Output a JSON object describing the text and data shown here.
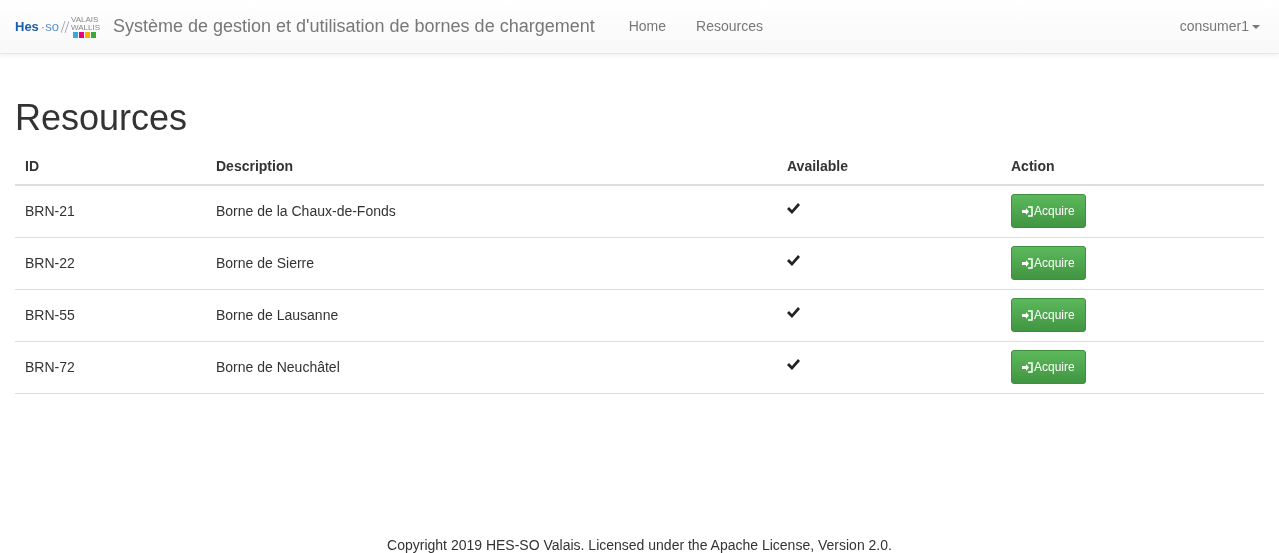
{
  "navbar": {
    "logo": {
      "brand": "Hes",
      "brand_suffix": "·so",
      "region": [
        "VALAIS",
        "WALLIS"
      ]
    },
    "title": "Système de gestion et d'utilisation de bornes de chargement",
    "links": [
      {
        "label": "Home",
        "selected": false
      },
      {
        "label": "Resources",
        "selected": false
      }
    ],
    "user": "consumer1"
  },
  "heading": "Resources",
  "table": {
    "columns": [
      "ID",
      "Description",
      "Available",
      "Action"
    ],
    "rows": [
      {
        "id": "BRN-21",
        "description": "Borne de la Chaux-de-Fonds",
        "available": true,
        "action": "Acquire"
      },
      {
        "id": "BRN-22",
        "description": "Borne de Sierre",
        "available": true,
        "action": "Acquire"
      },
      {
        "id": "BRN-55",
        "description": "Borne de Lausanne",
        "available": true,
        "action": "Acquire"
      },
      {
        "id": "BRN-72",
        "description": "Borne de Neuchâtel",
        "available": true,
        "action": "Acquire"
      }
    ]
  },
  "footer": "Copyright 2019 HES-SO Valais. Licensed under the Apache License, Version 2.0."
}
